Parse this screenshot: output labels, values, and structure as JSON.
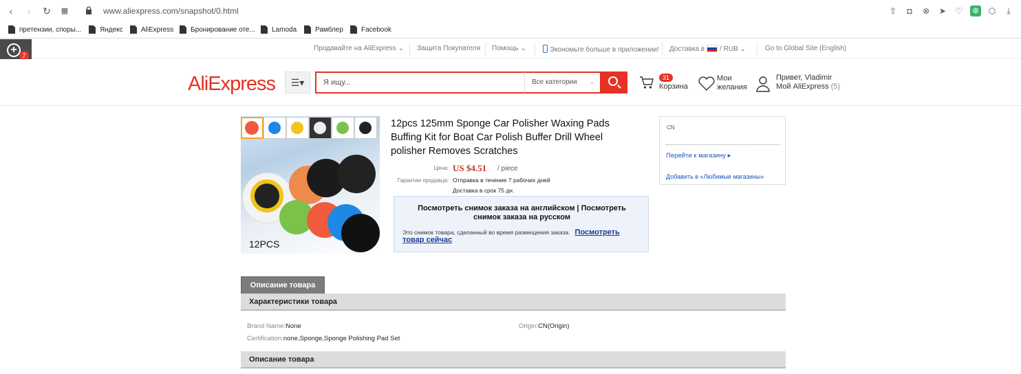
{
  "browser": {
    "url": "www.aliexpress.com/snapshot/0.html",
    "bookmarks": [
      "претензии, споры...",
      "Яндекс",
      "AliExpress",
      "Бронирование оте...",
      "Lamoda",
      "Рамблер",
      "Facebook"
    ]
  },
  "widget": {
    "badge": "7"
  },
  "top_links": {
    "sell": "Продавайте на AliExpress",
    "buyer_protection": "Защита Покупателя",
    "help": "Помощь",
    "app": "Экономьте больше в приложении!",
    "ship_to": "Доставка в",
    "currency": "/ RUB",
    "global": "Go to Global Site (English)"
  },
  "header": {
    "logo": "AliExpress",
    "search_placeholder": "Я ищу...",
    "category": "Все категории",
    "cart_count": "31",
    "cart_label": "Корзина",
    "wishlist_line1": "Мои",
    "wishlist_line2": "желания",
    "greeting": "Привет, Vladimir",
    "my_ali": "Мой AliExpress",
    "my_ali_count": "(5)"
  },
  "product": {
    "image_label": "12PCS",
    "title": "12pcs 125mm Sponge Car Polisher Waxing Pads Buffing Kit for Boat Car Polish Buffer Drill Wheel polisher Removes Scratches",
    "price_label": "Цена:",
    "price": "US $4.51",
    "price_unit": "/ piece",
    "guarantee_label": "Гарантии продавца:",
    "dispatch": "Отправка в течение 7 рабочих дней",
    "delivery": "Доставка в срок 75 дн."
  },
  "notice": {
    "head_line1": "Посмотреть снимок заказа на английском | Посмотреть",
    "head_line2": "снимок заказа на русском",
    "body": "Это снимок товара, сделанный во время размещения заказа.",
    "link": "Посмотреть товар сейчас"
  },
  "store": {
    "country": "CN",
    "go_to_store": "Перейти к магазину ▸",
    "add_favorite": "Добавить в «Любимые магазины»"
  },
  "tabs": {
    "description": "Описание товара"
  },
  "specs": {
    "title": "Характеристики товара",
    "brand_key": "Brand Name:",
    "brand_val": "None",
    "origin_key": "Origin:",
    "origin_val": "CN(Origin)",
    "cert_key": "Certification:",
    "cert_val": "none,Sponge,Sponge Polishing Pad Set"
  },
  "description_section": "Описание товара",
  "colors": {
    "brand": "#e43225",
    "link": "#1a56b8"
  }
}
